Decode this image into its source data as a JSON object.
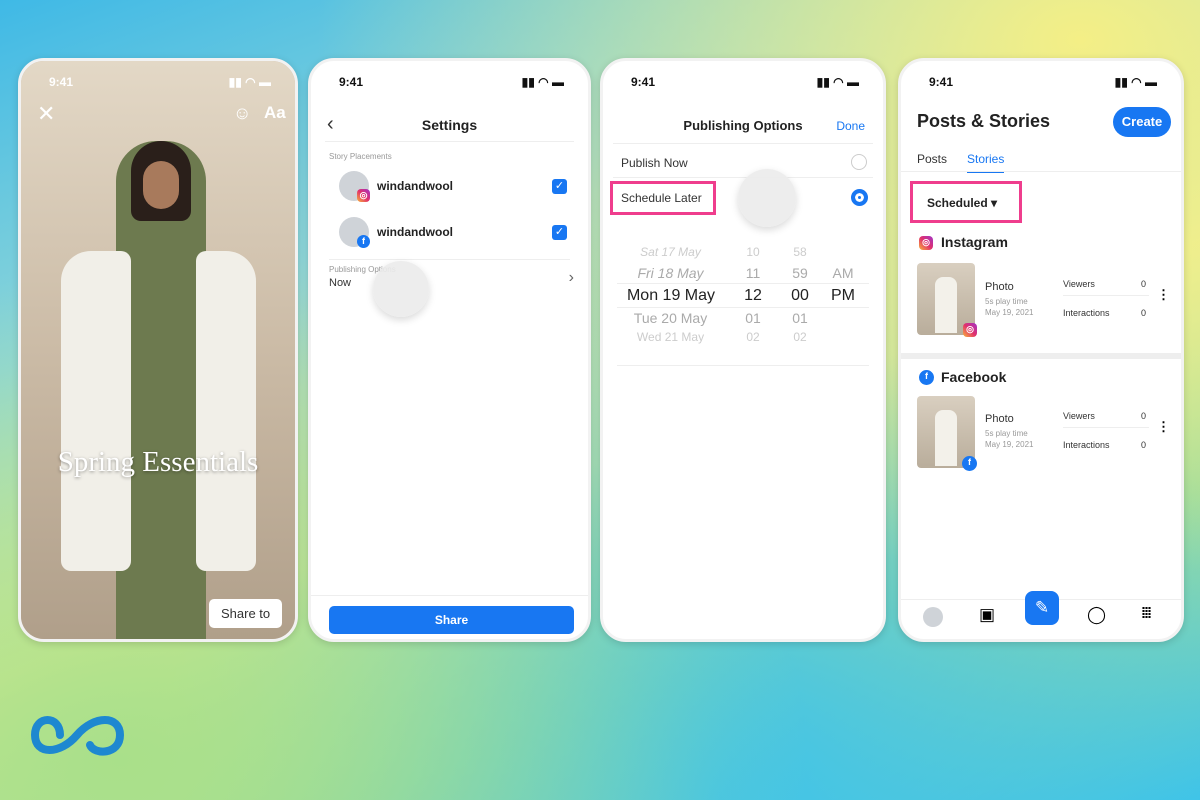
{
  "status_time": "9:41",
  "screen1": {
    "story_text": "Spring Essentials",
    "share_button": "Share to",
    "text_tool": "Aa"
  },
  "screen2": {
    "title": "Settings",
    "section": "Story Placements",
    "accounts": [
      {
        "name": "windandwool",
        "platform": "instagram",
        "checked": true
      },
      {
        "name": "windandwool",
        "platform": "facebook",
        "checked": true
      }
    ],
    "publishing_label": "Publishing Options",
    "publishing_value": "Now",
    "share_button": "Share"
  },
  "screen3": {
    "title": "Publishing Options",
    "done": "Done",
    "publish_now": "Publish Now",
    "schedule_later": "Schedule Later",
    "selected": "Schedule Later",
    "picker": {
      "days": [
        "Sat 17 May",
        "Fri 18 May",
        "Mon 19 May",
        "Tue 20 May",
        "Wed 21 May"
      ],
      "hours": [
        "10",
        "11",
        "12",
        "01",
        "02"
      ],
      "minutes": [
        "58",
        "59",
        "00",
        "01",
        "02"
      ],
      "ampm": [
        "AM",
        "PM"
      ],
      "selected": {
        "day": "Mon 19 May",
        "hour": "12",
        "minute": "00",
        "ampm": "PM"
      }
    }
  },
  "screen4": {
    "title": "Posts & Stories",
    "create": "Create",
    "tabs": [
      "Posts",
      "Stories"
    ],
    "active_tab": "Stories",
    "filter": "Scheduled",
    "sections": [
      {
        "platform": "Instagram",
        "type": "Photo",
        "duration": "5s play time",
        "date": "May 19, 2021",
        "viewers_label": "Viewers",
        "viewers": "0",
        "interactions_label": "Interactions",
        "interactions": "0"
      },
      {
        "platform": "Facebook",
        "type": "Photo",
        "duration": "5s play time",
        "date": "May 19, 2021",
        "viewers_label": "Viewers",
        "viewers": "0",
        "interactions_label": "Interactions",
        "interactions": "0"
      }
    ]
  },
  "colors": {
    "accent": "#1877f2",
    "highlight": "#ef3d8d"
  }
}
